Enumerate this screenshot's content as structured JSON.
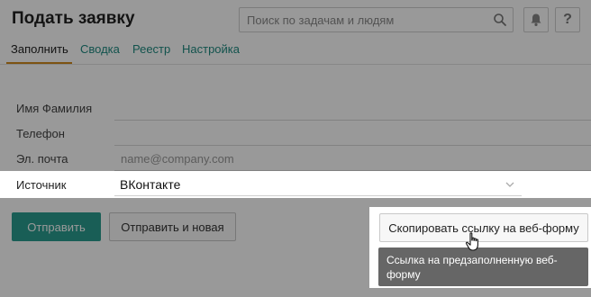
{
  "header": {
    "title": "Подать заявку",
    "search_placeholder": "Поиск по задачам и людям",
    "help_label": "?"
  },
  "tabs": [
    {
      "label": "Заполнить",
      "active": true
    },
    {
      "label": "Сводка",
      "active": false
    },
    {
      "label": "Реестр",
      "active": false
    },
    {
      "label": "Настройка",
      "active": false
    }
  ],
  "form": {
    "name_label": "Имя Фамилия",
    "name_value": "",
    "phone_label": "Телефон",
    "phone_value": "",
    "email_label": "Эл. почта",
    "email_placeholder": "name@company.com",
    "source_label": "Источник",
    "source_value": "ВКонтакте"
  },
  "buttons": {
    "send": "Отправить",
    "send_new": "Отправить и новая",
    "copy_link": "Скопировать ссылку на веб-форму"
  },
  "tooltip": {
    "text": "Ссылка на предзаполненную веб-форму"
  },
  "colors": {
    "accent": "#2a9d8f",
    "tab_link": "#1f8a80",
    "tab_underline": "#d08a1e",
    "tooltip_bg": "#666666"
  }
}
